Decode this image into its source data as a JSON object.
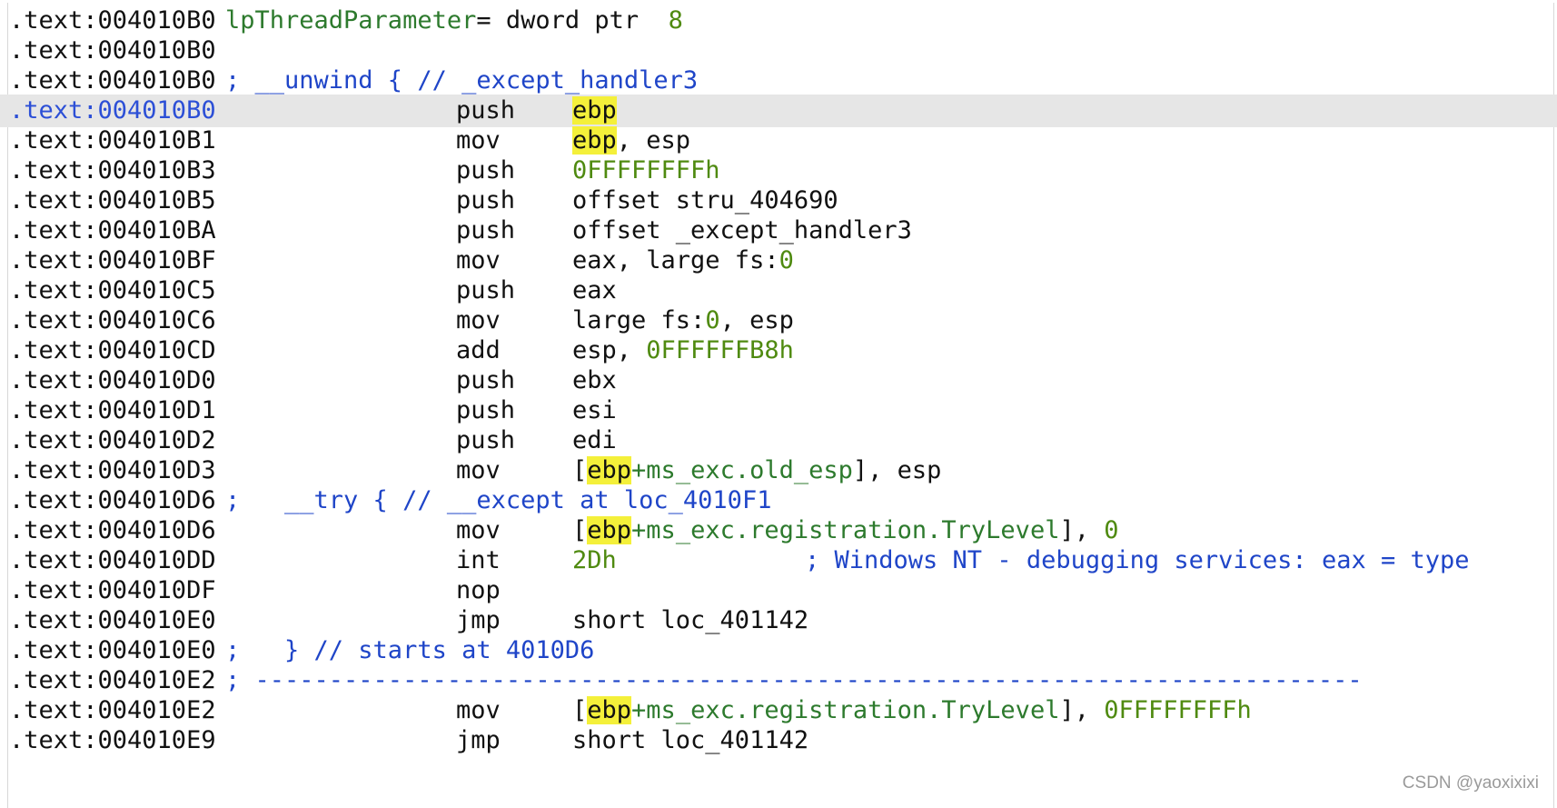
{
  "rows": [
    {
      "addr": ".text:004010B0",
      "ident": "lpThreadParameter",
      "eq": "= dword ptr  ",
      "num": "8"
    },
    {
      "addr": ".text:004010B0"
    },
    {
      "addr": ".text:004010B0",
      "comment": "; __unwind { // _except_handler3"
    },
    {
      "addr": ".text:004010B0",
      "mnem": "push",
      "reg_hl": "ebp"
    },
    {
      "addr": ".text:004010B1",
      "mnem": "mov",
      "reg_hl": "ebp",
      "rest": ", esp"
    },
    {
      "addr": ".text:004010B3",
      "mnem": "push",
      "num": "0FFFFFFFFh"
    },
    {
      "addr": ".text:004010B5",
      "mnem": "push",
      "ops": "offset stru_404690"
    },
    {
      "addr": ".text:004010BA",
      "mnem": "push",
      "ops": "offset _except_handler3"
    },
    {
      "addr": ".text:004010BF",
      "mnem": "mov",
      "ops": "eax, large fs:",
      "num": "0"
    },
    {
      "addr": ".text:004010C5",
      "mnem": "push",
      "ops": "eax"
    },
    {
      "addr": ".text:004010C6",
      "mnem": "mov",
      "ops": "large fs:",
      "num": "0",
      "rest": ", esp"
    },
    {
      "addr": ".text:004010CD",
      "mnem": "add",
      "ops": "esp, ",
      "num": "0FFFFFFB8h"
    },
    {
      "addr": ".text:004010D0",
      "mnem": "push",
      "ops": "ebx"
    },
    {
      "addr": ".text:004010D1",
      "mnem": "push",
      "ops": "esi"
    },
    {
      "addr": ".text:004010D2",
      "mnem": "push",
      "ops": "edi"
    },
    {
      "addr": ".text:004010D3",
      "mnem": "mov",
      "pre": "[",
      "reg_hl": "ebp",
      "mid": "+ms_exc.old_esp",
      "rest": "], esp"
    },
    {
      "addr": ".text:004010D6",
      "comment": ";   __try { // __except at loc_4010F1"
    },
    {
      "addr": ".text:004010D6",
      "mnem": "mov",
      "pre": "[",
      "reg_hl": "ebp",
      "mid": "+ms_exc.registration.TryLevel",
      "rest": "], ",
      "num": "0"
    },
    {
      "addr": ".text:004010DD",
      "mnem": "int",
      "num": "2Dh",
      "tail_comment": "; Windows NT - debugging services: eax = type"
    },
    {
      "addr": ".text:004010DF",
      "mnem": "nop"
    },
    {
      "addr": ".text:004010E0",
      "mnem": "jmp",
      "ops": "short loc_401142"
    },
    {
      "addr": ".text:004010E0",
      "comment": ";   } // starts at 4010D6"
    },
    {
      "addr": ".text:004010E2",
      "comment": "; ---------------------------------------------------------------------------"
    },
    {
      "addr": ".text:004010E2",
      "mnem": "mov",
      "pre": "[",
      "reg_hl": "ebp",
      "mid": "+ms_exc.registration.TryLevel",
      "rest": "], ",
      "num": "0FFFFFFFFh"
    },
    {
      "addr": ".text:004010E9",
      "mnem": "jmp",
      "ops": "short loc_401142"
    }
  ],
  "selected_row": 3,
  "watermark": "CSDN @yaoxixixi",
  "colors": {
    "selected_addr": "#2c4fd6",
    "comment": "#1f45c8",
    "number": "#4f8a10",
    "highlight": "#f4f03a",
    "selection_bg": "#e6e6e6"
  }
}
